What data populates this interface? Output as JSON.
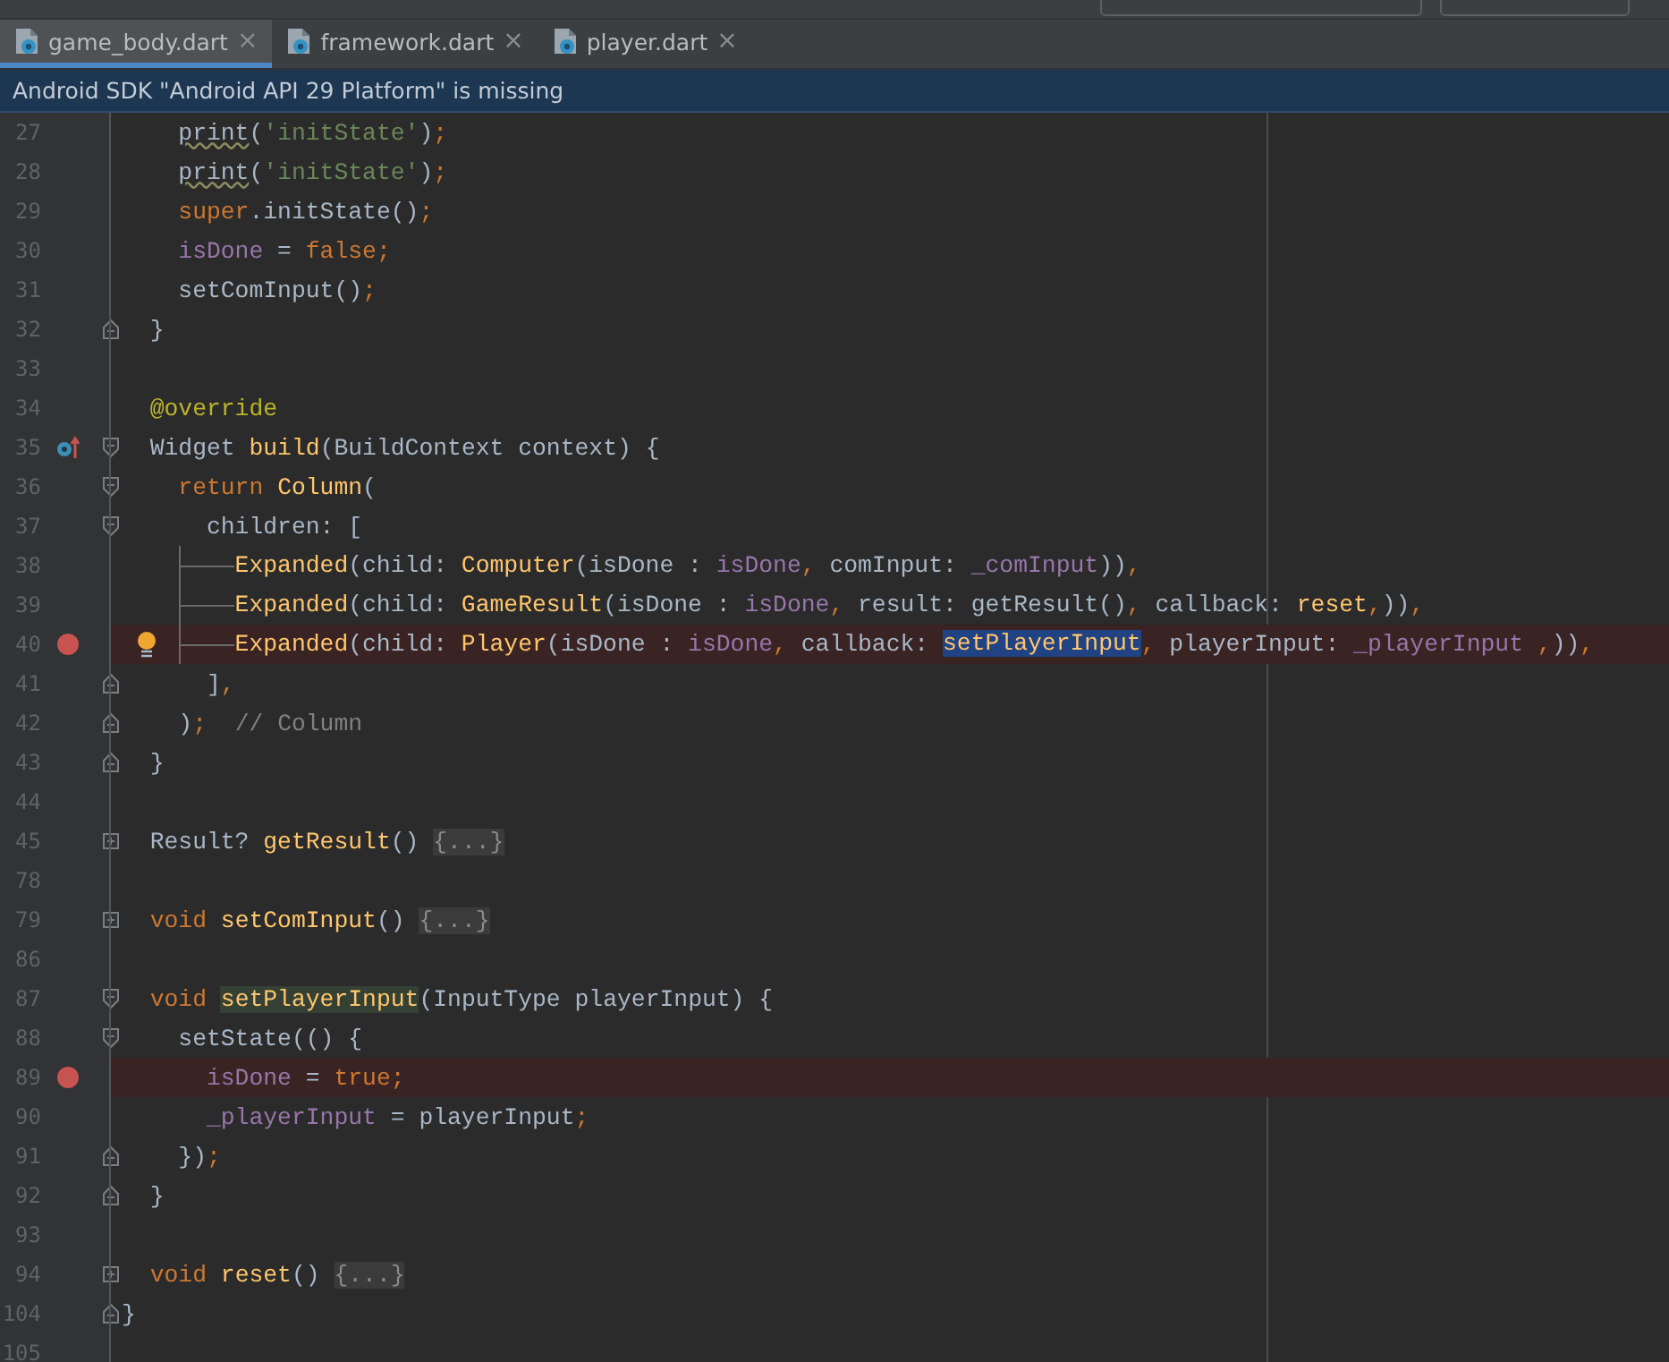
{
  "tabs": [
    {
      "label": "game_body.dart",
      "close": "×",
      "selected": true
    },
    {
      "label": "framework.dart",
      "close": "×",
      "selected": false
    },
    {
      "label": "player.dart",
      "close": "×",
      "selected": false
    }
  ],
  "notification": "Android SDK \"Android API 29 Platform\" is missing",
  "editor": {
    "lines": [
      {
        "number": "27",
        "kind": "code",
        "tokens": [
          {
            "text": "    print",
            "kind": "warn"
          },
          {
            "text": "(",
            "kind": "plain"
          },
          {
            "text": "'initState'",
            "kind": "str"
          },
          {
            "text": ")",
            "kind": "plain"
          },
          {
            "text": ";",
            "kind": "kw"
          }
        ]
      },
      {
        "number": "28",
        "kind": "code",
        "tokens": [
          {
            "text": "    print",
            "kind": "warn"
          },
          {
            "text": "(",
            "kind": "plain"
          },
          {
            "text": "'initState'",
            "kind": "str"
          },
          {
            "text": ")",
            "kind": "plain"
          },
          {
            "text": ";",
            "kind": "kw"
          }
        ]
      },
      {
        "number": "29",
        "kind": "code",
        "tokens": [
          {
            "text": "    super",
            "kind": "kw"
          },
          {
            "text": ".initState()",
            "kind": "plain"
          },
          {
            "text": ";",
            "kind": "kw"
          }
        ]
      },
      {
        "number": "30",
        "kind": "code",
        "tokens": [
          {
            "text": "    isDone",
            "kind": "field"
          },
          {
            "text": " = ",
            "kind": "plain"
          },
          {
            "text": "false",
            "kind": "kw"
          },
          {
            "text": ";",
            "kind": "kw"
          }
        ]
      },
      {
        "number": "31",
        "kind": "code",
        "tokens": [
          {
            "text": "    setComInput()",
            "kind": "plain"
          },
          {
            "text": ";",
            "kind": "kw"
          }
        ]
      },
      {
        "number": "32",
        "kind": "code",
        "fold_end": true,
        "tokens": [
          {
            "text": "  }",
            "kind": "plain"
          }
        ]
      },
      {
        "number": "33",
        "kind": "blank"
      },
      {
        "number": "34",
        "kind": "code",
        "tokens": [
          {
            "text": "  @override",
            "kind": "anno"
          }
        ]
      },
      {
        "number": "35",
        "kind": "override",
        "fold_start": true,
        "tokens": [
          {
            "text": "  Widget ",
            "kind": "plain"
          },
          {
            "text": "build",
            "kind": "fn"
          },
          {
            "text": "(BuildContext context) {",
            "kind": "plain"
          }
        ]
      },
      {
        "number": "36",
        "kind": "code",
        "fold_start": true,
        "tokens": [
          {
            "text": "    return",
            "kind": "kw"
          },
          {
            "text": " Column",
            "kind": "fn"
          },
          {
            "text": "(",
            "kind": "plain"
          }
        ]
      },
      {
        "number": "37",
        "kind": "code",
        "fold_start": true,
        "tokens": [
          {
            "text": "      children: [",
            "kind": "plain"
          }
        ]
      },
      {
        "number": "38",
        "kind": "code",
        "widget_guide": true,
        "tokens": [
          {
            "text": "        Expanded",
            "kind": "fn"
          },
          {
            "text": "(child: ",
            "kind": "plain"
          },
          {
            "text": "Computer",
            "kind": "fn"
          },
          {
            "text": "(isDone : ",
            "kind": "plain"
          },
          {
            "text": "isDone",
            "kind": "field"
          },
          {
            "text": ",",
            "kind": "kw"
          },
          {
            "text": " comInput: ",
            "kind": "plain"
          },
          {
            "text": "_comInput",
            "kind": "field"
          },
          {
            "text": "))",
            "kind": "plain"
          },
          {
            "text": ",",
            "kind": "kw"
          }
        ]
      },
      {
        "number": "39",
        "kind": "code",
        "widget_guide": true,
        "tokens": [
          {
            "text": "        Expanded",
            "kind": "fn"
          },
          {
            "text": "(child: ",
            "kind": "plain"
          },
          {
            "text": "GameResult",
            "kind": "fn"
          },
          {
            "text": "(isDone : ",
            "kind": "plain"
          },
          {
            "text": "isDone",
            "kind": "field"
          },
          {
            "text": ",",
            "kind": "kw"
          },
          {
            "text": " result: getResult()",
            "kind": "plain"
          },
          {
            "text": ",",
            "kind": "kw"
          },
          {
            "text": " callback: ",
            "kind": "plain"
          },
          {
            "text": "reset",
            "kind": "fn"
          },
          {
            "text": ",",
            "kind": "kw"
          },
          {
            "text": "))",
            "kind": "plain"
          },
          {
            "text": ",",
            "kind": "kw"
          }
        ]
      },
      {
        "number": "40",
        "kind": "intention",
        "breakpoint": true,
        "widget_guide": true,
        "tokens": [
          {
            "text": "        Expanded",
            "kind": "fn"
          },
          {
            "text": "(child: ",
            "kind": "plain"
          },
          {
            "text": "Player",
            "kind": "fn"
          },
          {
            "text": "(isDone : ",
            "kind": "plain"
          },
          {
            "text": "isDone",
            "kind": "field"
          },
          {
            "text": ",",
            "kind": "kw"
          },
          {
            "text": " callback: ",
            "kind": "plain"
          },
          {
            "text": "setPlayerInput",
            "kind": "selected"
          },
          {
            "text": ",",
            "kind": "kw"
          },
          {
            "text": " playerInput: ",
            "kind": "plain"
          },
          {
            "text": "_playerInput",
            "kind": "field"
          },
          {
            "text": " ,",
            "kind": "kw"
          },
          {
            "text": "))",
            "kind": "plain"
          },
          {
            "text": ",",
            "kind": "kw"
          }
        ]
      },
      {
        "number": "41",
        "kind": "code",
        "fold_end": true,
        "tokens": [
          {
            "text": "      ]",
            "kind": "plain"
          },
          {
            "text": ",",
            "kind": "kw"
          }
        ]
      },
      {
        "number": "42",
        "kind": "code",
        "fold_end": true,
        "tokens": [
          {
            "text": "    )",
            "kind": "plain"
          },
          {
            "text": ";",
            "kind": "kw"
          },
          {
            "text": "  // Column",
            "kind": "comment"
          }
        ]
      },
      {
        "number": "43",
        "kind": "code",
        "fold_end": true,
        "tokens": [
          {
            "text": "  }",
            "kind": "plain"
          }
        ]
      },
      {
        "number": "44",
        "kind": "blank"
      },
      {
        "number": "45",
        "kind": "code",
        "collapsed": true,
        "tokens": [
          {
            "text": "  Result? ",
            "kind": "plain"
          },
          {
            "text": "getResult",
            "kind": "fn"
          },
          {
            "text": "() ",
            "kind": "plain"
          },
          {
            "text": "{...}",
            "kind": "folded"
          }
        ]
      },
      {
        "number": "78",
        "kind": "blank"
      },
      {
        "number": "79",
        "kind": "code",
        "collapsed": true,
        "tokens": [
          {
            "text": "  void",
            "kind": "kw"
          },
          {
            "text": " setComInput",
            "kind": "fn"
          },
          {
            "text": "() ",
            "kind": "plain"
          },
          {
            "text": "{...}",
            "kind": "folded"
          }
        ]
      },
      {
        "number": "86",
        "kind": "blank"
      },
      {
        "number": "87",
        "kind": "code",
        "fold_start": true,
        "tokens": [
          {
            "text": "  void",
            "kind": "kw"
          },
          {
            "text": " setPlayerInput",
            "kind": "usage"
          },
          {
            "text": "(InputType playerInput) {",
            "kind": "plain"
          }
        ]
      },
      {
        "number": "88",
        "kind": "code",
        "fold_start": true,
        "tokens": [
          {
            "text": "    setState(() {",
            "kind": "plain"
          }
        ]
      },
      {
        "number": "89",
        "kind": "code",
        "breakpoint": true,
        "tokens": [
          {
            "text": "      isDone",
            "kind": "field"
          },
          {
            "text": " = ",
            "kind": "plain"
          },
          {
            "text": "true",
            "kind": "kw"
          },
          {
            "text": ";",
            "kind": "kw"
          }
        ]
      },
      {
        "number": "90",
        "kind": "code",
        "tokens": [
          {
            "text": "      _playerInput",
            "kind": "field"
          },
          {
            "text": " = playerInput",
            "kind": "plain"
          },
          {
            "text": ";",
            "kind": "kw"
          }
        ]
      },
      {
        "number": "91",
        "kind": "code",
        "fold_end": true,
        "tokens": [
          {
            "text": "    })",
            "kind": "plain"
          },
          {
            "text": ";",
            "kind": "kw"
          }
        ]
      },
      {
        "number": "92",
        "kind": "code",
        "fold_end": true,
        "tokens": [
          {
            "text": "  }",
            "kind": "plain"
          }
        ]
      },
      {
        "number": "93",
        "kind": "blank"
      },
      {
        "number": "94",
        "kind": "code",
        "collapsed": true,
        "tokens": [
          {
            "text": "  void",
            "kind": "kw"
          },
          {
            "text": " reset",
            "kind": "fn"
          },
          {
            "text": "() ",
            "kind": "plain"
          },
          {
            "text": "{...}",
            "kind": "folded"
          }
        ]
      },
      {
        "number": "104",
        "kind": "code",
        "fold_end": true,
        "tokens": [
          {
            "text": "}",
            "kind": "plain"
          }
        ]
      },
      {
        "number": "105",
        "kind": "blank"
      }
    ]
  }
}
